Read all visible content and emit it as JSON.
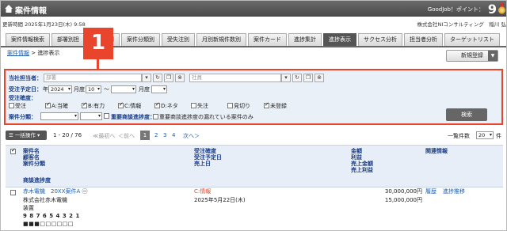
{
  "titlebar": {
    "title": "案件情報",
    "points_label": "GoodJob！ポイント：",
    "points": "9"
  },
  "infobar": {
    "updated": "更新時間 2025年1月23日(木) 9:58",
    "company": "株式会社NIコンサルティング　稲川 弘"
  },
  "tabs": [
    "案件情報検索",
    "部署別担当",
    "顧客別",
    "案件分類別",
    "受失注別",
    "月別新規件数別",
    "案件カード",
    "進捗集計",
    "進捗表示",
    "サクセス分析",
    "担当者分析",
    "ターゲットリスト"
  ],
  "tab_labels": [
    "案件情報検索",
    "部署別担",
    "ン顧客別",
    "案件分類別",
    "受失注別",
    "月別新規件数別",
    "案件カード",
    "進捗集計",
    "進捗表示",
    "サクセス分析",
    "担当者分析",
    "ターゲットリスト"
  ],
  "active_tab": "進捗表示",
  "breadcrumb": {
    "root": "案件情報",
    "sep": ">",
    "current": "進捗表示"
  },
  "new_button": "新規登録",
  "step_badge": "1",
  "search": {
    "owner_label": "当社担当者：",
    "dept_placeholder": "部署",
    "staff_placeholder": "社員",
    "date_label": "受注予定日：",
    "year_prefix": "年",
    "year": "2024",
    "month_unit": "月度",
    "month": "10",
    "tilde": "〜",
    "to_year": "",
    "to_month": "",
    "accuracy_label": "受注確度：",
    "checks": [
      {
        "label": "受注",
        "checked": false
      },
      {
        "label": "A:当確",
        "checked": true
      },
      {
        "label": "B:有力",
        "checked": true
      },
      {
        "label": "C:情報",
        "checked": true
      },
      {
        "label": "D:ネタ",
        "checked": true
      },
      {
        "label": "失注",
        "checked": false
      },
      {
        "label": "見切り",
        "checked": false
      },
      {
        "label": "未登録",
        "checked": true
      }
    ],
    "category_label": "案件分類：",
    "important_label": "重要商談進捗度：",
    "important_check": "重要商談進捗度の漏れている案件のみ",
    "search_button": "検索"
  },
  "list": {
    "bulk": "一括操作",
    "range": "1 - 20 / 76",
    "first": "≪最初へ",
    "prev": "＜前へ",
    "pages": [
      "1",
      "2",
      "3",
      "4"
    ],
    "next": "次へ＞",
    "per_page_label": "一覧件数",
    "per_page": "20",
    "per_page_unit": "件"
  },
  "columns": {
    "c1": [
      "案件名",
      "顧客名",
      "案件分類"
    ],
    "c1b": "商談進捗度",
    "c2": [
      "受注確度",
      "受注予定日",
      "売上日"
    ],
    "c3": [
      "金額",
      "利益",
      "売上金額",
      "売上利益"
    ],
    "c4": "関連情報"
  },
  "rows": [
    {
      "name": "赤木電機　20XX案件A",
      "customer": "株式会社赤木電機",
      "category": "装置",
      "progress": "9 8 7 6 5 4 3 2 1",
      "progress_marks": "■■■□□□□□□",
      "accuracy": "C:情報",
      "date": "2025年5月22日(木)",
      "amount": "30,000,000円",
      "profit": "15,000,000円",
      "link1": "履歴",
      "link2": "進捗推移"
    }
  ]
}
